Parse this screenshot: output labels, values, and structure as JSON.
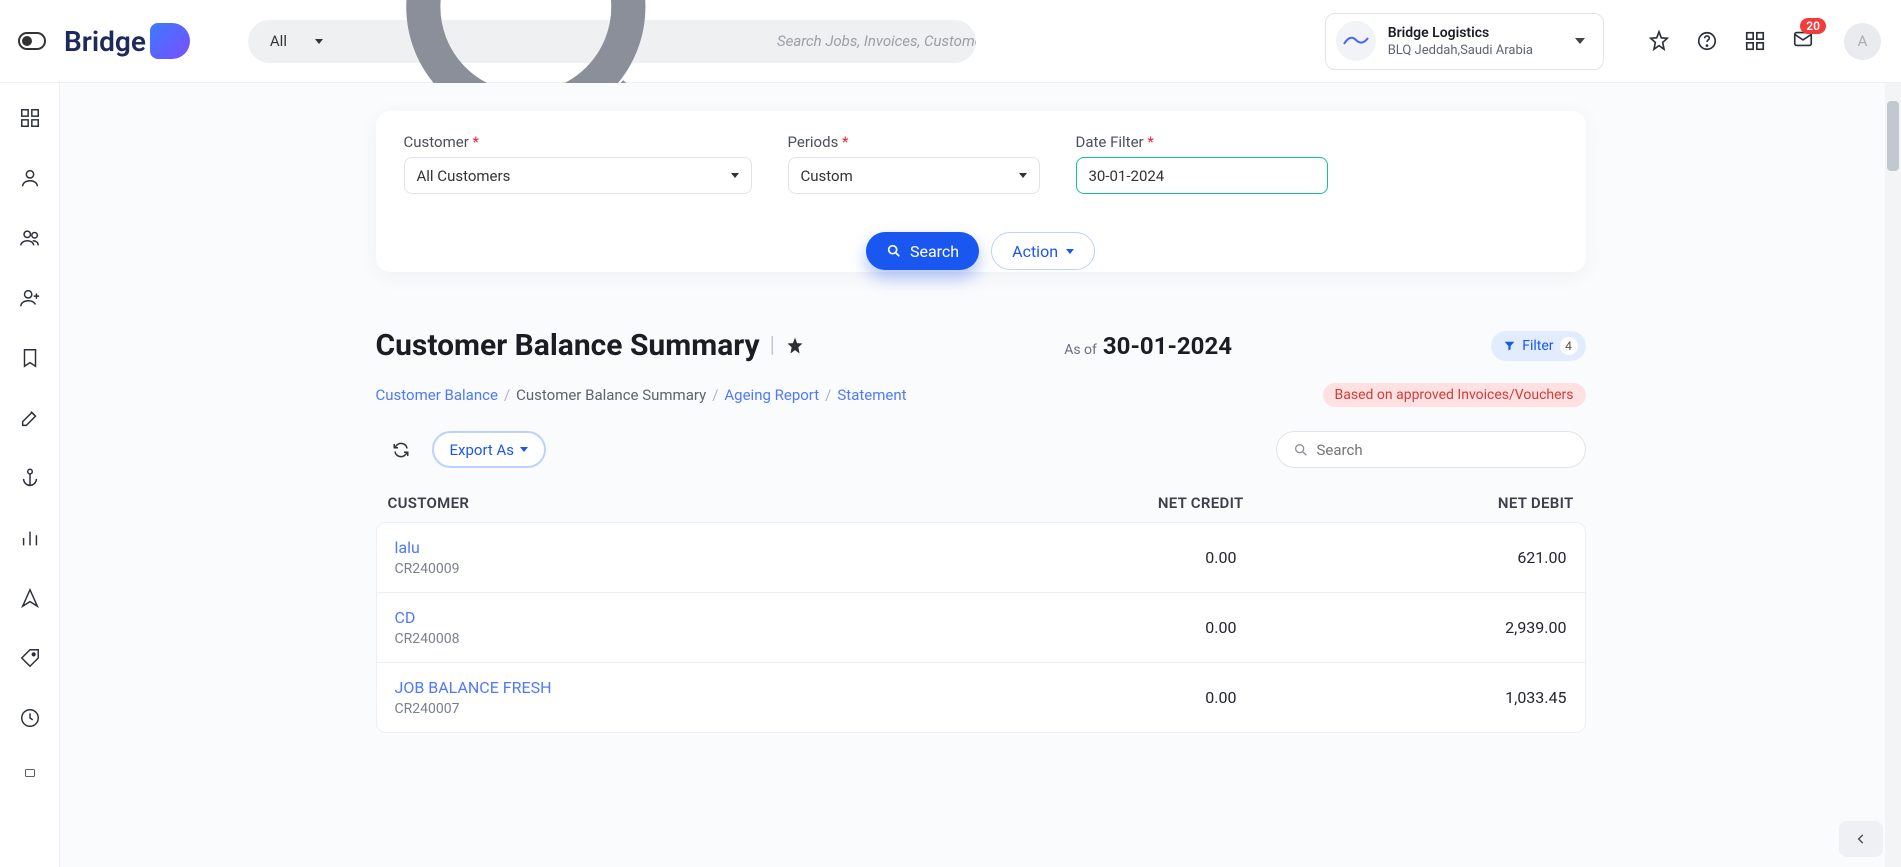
{
  "header": {
    "search_scope": "All",
    "search_placeholder": "Search Jobs, Invoices, Customers & More..",
    "company_name": "Bridge Logistics",
    "company_subtitle": "BLQ Jeddah,Saudi Arabia",
    "notification_count": "20",
    "avatar_initial": "A"
  },
  "filters": {
    "customer_label": "Customer",
    "customer_value": "All Customers",
    "periods_label": "Periods",
    "periods_value": "Custom",
    "datefilter_label": "Date Filter",
    "datefilter_value": "30-01-2024",
    "search_btn": "Search",
    "action_btn": "Action"
  },
  "page": {
    "title": "Customer Balance Summary",
    "asof_label": "As of",
    "asof_date": "30-01-2024",
    "filter_label": "Filter",
    "filter_count": "4",
    "status_chip": "Based on approved Invoices/Vouchers"
  },
  "breadcrumb": {
    "a": "Customer Balance",
    "b": "Customer Balance Summary",
    "c": "Ageing Report",
    "d": "Statement"
  },
  "toolbar": {
    "export_label": "Export As",
    "search_placeholder": "Search"
  },
  "table": {
    "headers": {
      "customer": "CUSTOMER",
      "net_credit": "NET CREDIT",
      "net_debit": "NET DEBIT"
    },
    "rows": [
      {
        "name": "lalu",
        "code": "CR240009",
        "credit": "0.00",
        "debit": "621.00"
      },
      {
        "name": "CD",
        "code": "CR240008",
        "credit": "0.00",
        "debit": "2,939.00"
      },
      {
        "name": "JOB BALANCE FRESH",
        "code": "CR240007",
        "credit": "0.00",
        "debit": "1,033.45"
      }
    ]
  }
}
